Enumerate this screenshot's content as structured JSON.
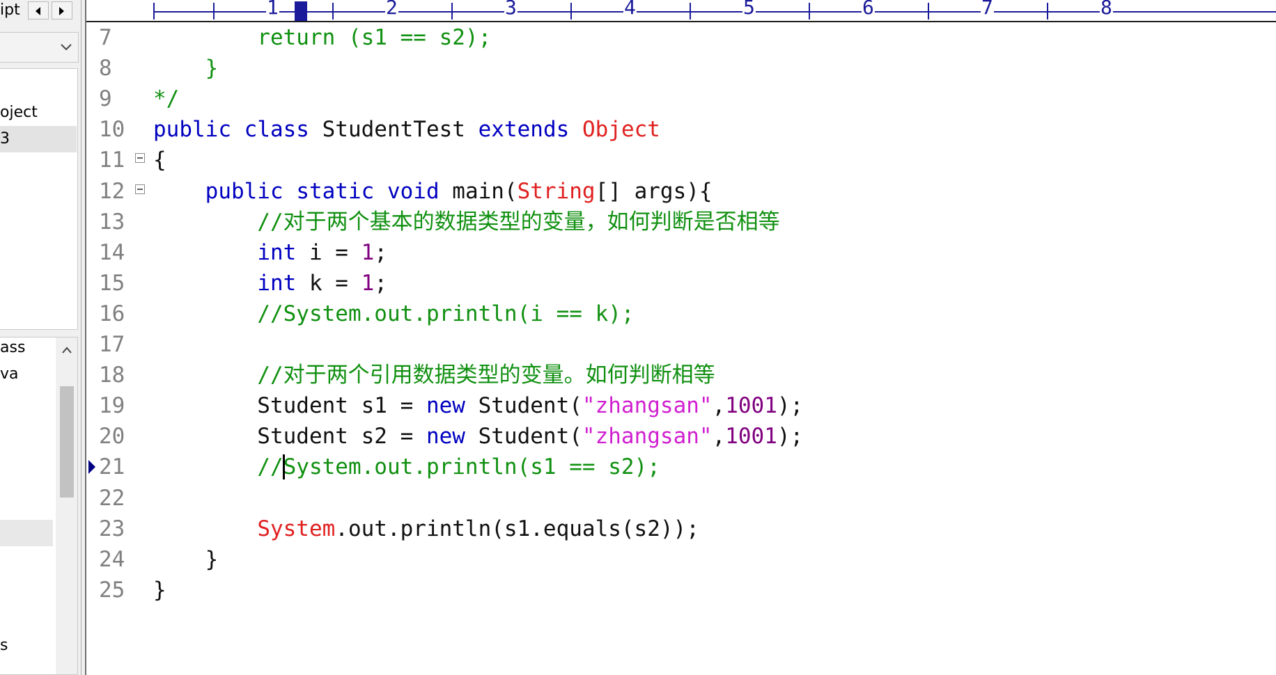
{
  "left_panel": {
    "tab_label": "ipt",
    "tree_items": [
      "oject",
      "3"
    ],
    "file_items": [
      "ass",
      "va",
      "s"
    ]
  },
  "ruler": {
    "numbers": [
      "1",
      "2",
      "3",
      "4",
      "5",
      "6",
      "7",
      "8"
    ]
  },
  "code_lines": [
    {
      "n": "7",
      "tokens": [
        [
          "pl",
          "        "
        ],
        [
          "cm",
          "return (s1 == s2);"
        ]
      ]
    },
    {
      "n": "8",
      "tokens": [
        [
          "pl",
          "    "
        ],
        [
          "cm",
          "}"
        ]
      ]
    },
    {
      "n": "9",
      "tokens": [
        [
          "cm",
          "*/"
        ]
      ]
    },
    {
      "n": "10",
      "tokens": [
        [
          "kw",
          "public"
        ],
        [
          "pl",
          " "
        ],
        [
          "kw",
          "class"
        ],
        [
          "pl",
          " StudentTest "
        ],
        [
          "kw",
          "extends"
        ],
        [
          "pl",
          " "
        ],
        [
          "cls",
          "Object"
        ]
      ]
    },
    {
      "n": "11",
      "fold": true,
      "tokens": [
        [
          "pl",
          "{"
        ]
      ]
    },
    {
      "n": "12",
      "fold": true,
      "tokens": [
        [
          "pl",
          "    "
        ],
        [
          "kw",
          "public"
        ],
        [
          "pl",
          " "
        ],
        [
          "kw",
          "static"
        ],
        [
          "pl",
          " "
        ],
        [
          "kw",
          "void"
        ],
        [
          "pl",
          " main("
        ],
        [
          "cls",
          "String"
        ],
        [
          "pl",
          "[] args){"
        ]
      ]
    },
    {
      "n": "13",
      "tokens": [
        [
          "pl",
          "        "
        ],
        [
          "cm",
          "//对于两个基本的数据类型的变量，如何判断是否相等"
        ]
      ]
    },
    {
      "n": "14",
      "tokens": [
        [
          "pl",
          "        "
        ],
        [
          "kw",
          "int"
        ],
        [
          "pl",
          " i = "
        ],
        [
          "num",
          "1"
        ],
        [
          "pl",
          ";"
        ]
      ]
    },
    {
      "n": "15",
      "tokens": [
        [
          "pl",
          "        "
        ],
        [
          "kw",
          "int"
        ],
        [
          "pl",
          " k = "
        ],
        [
          "num",
          "1"
        ],
        [
          "pl",
          ";"
        ]
      ]
    },
    {
      "n": "16",
      "tokens": [
        [
          "pl",
          "        "
        ],
        [
          "cm",
          "//System.out.println(i == k);"
        ]
      ]
    },
    {
      "n": "17",
      "tokens": []
    },
    {
      "n": "18",
      "tokens": [
        [
          "pl",
          "        "
        ],
        [
          "cm",
          "//对于两个引用数据类型的变量。如何判断相等"
        ]
      ]
    },
    {
      "n": "19",
      "tokens": [
        [
          "pl",
          "        Student s1 = "
        ],
        [
          "kw",
          "new"
        ],
        [
          "pl",
          " Student("
        ],
        [
          "str",
          "\"zhangsan\""
        ],
        [
          "pl",
          ","
        ],
        [
          "num",
          "1001"
        ],
        [
          "pl",
          ");"
        ]
      ]
    },
    {
      "n": "20",
      "tokens": [
        [
          "pl",
          "        Student s2 = "
        ],
        [
          "kw",
          "new"
        ],
        [
          "pl",
          " Student("
        ],
        [
          "str",
          "\"zhangsan\""
        ],
        [
          "pl",
          ","
        ],
        [
          "num",
          "1001"
        ],
        [
          "pl",
          ");"
        ]
      ]
    },
    {
      "n": "21",
      "bookmark": true,
      "tokens": [
        [
          "pl",
          "        "
        ],
        [
          "cm",
          "//System.out.println(s1 == s2);"
        ]
      ]
    },
    {
      "n": "22",
      "tokens": []
    },
    {
      "n": "23",
      "tokens": [
        [
          "pl",
          "        "
        ],
        [
          "cls",
          "System"
        ],
        [
          "pl",
          ".out.println(s1.equals(s2));"
        ]
      ]
    },
    {
      "n": "24",
      "tokens": [
        [
          "pl",
          "    }"
        ]
      ]
    },
    {
      "n": "25",
      "tokens": [
        [
          "pl",
          "}"
        ]
      ]
    }
  ],
  "colors": {
    "keyword": "#0000c0",
    "class": "#e02020",
    "comment": "#109010",
    "string": "#d020d0",
    "number": "#800080",
    "line_number": "#808080",
    "ruler": "#1a1a9a"
  },
  "icons": {
    "tab_prev": "triangle-left-icon",
    "tab_next": "triangle-right-icon",
    "dropdown": "chevron-down-icon",
    "scroll_up": "chevron-up-icon",
    "fold": "fold-minus-icon",
    "bookmark": "bookmark-arrow-icon"
  }
}
